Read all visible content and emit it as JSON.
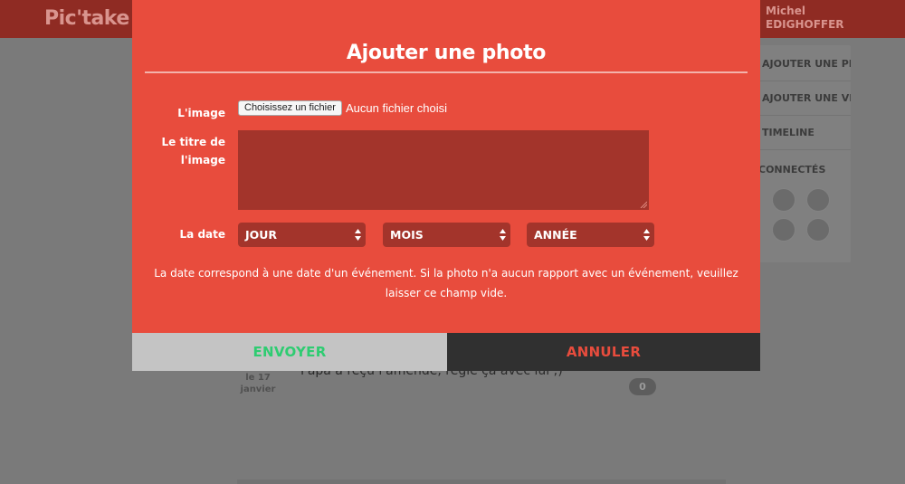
{
  "app": {
    "brand": "Pic'take",
    "user_first": "Michel",
    "user_last": "EDIGHOFFER"
  },
  "sidebar": {
    "items": [
      {
        "label": "AJOUTER UNE PHOTO"
      },
      {
        "label": "AJOUTER UNE VIDÉO"
      },
      {
        "label": "TIMELINE"
      }
    ],
    "connected_label": "CONNECTÉS"
  },
  "post": {
    "date_line1": "le 17",
    "date_line2": "janvier",
    "text": "Papa a reçu l'amende, règle ça avec lui ;)",
    "comment_count": "0"
  },
  "modal": {
    "title": "Ajouter une photo",
    "image_label": "L'image",
    "file_button": "Choisissez un fichier",
    "file_status": "Aucun fichier choisi",
    "title_label_line1": "Le titre de",
    "title_label_line2": "l'image",
    "title_value": "",
    "date_label": "La date",
    "day_select": "JOUR",
    "month_select": "MOIS",
    "year_select": "ANNÉE",
    "hint": "La date correspond à une date d'un événement. Si la photo n'a aucun rapport avec un événement, veuillez laisser ce champ vide.",
    "send_button": "ENVOYER",
    "cancel_button": "ANNULER"
  },
  "colors": {
    "modal_bg": "#e84c3d",
    "field_bg": "#a3342b",
    "send_text": "#2ecc71",
    "cancel_bg": "#303030"
  }
}
